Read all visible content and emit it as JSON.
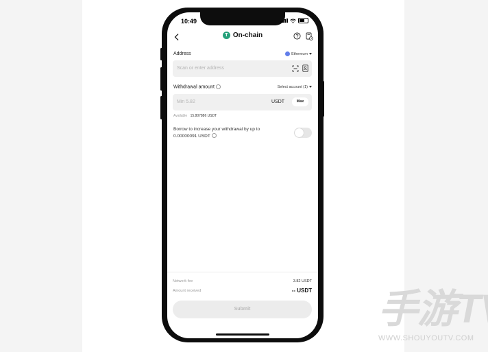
{
  "status_bar": {
    "time": "10:49"
  },
  "header": {
    "title": "On-chain",
    "coin_letter": "T"
  },
  "address": {
    "label": "Address",
    "network": "Ethereum",
    "placeholder": "Scan or enter address"
  },
  "withdrawal": {
    "label": "Withdrawal amount",
    "select_account": "Select account (1)",
    "placeholder": "Min 5.82",
    "currency": "USDT",
    "max_label": "Max",
    "available_label": "Available",
    "available_value": "15.807886 USDT"
  },
  "borrow": {
    "text_line1": "Borrow to increase your withdrawal by up to",
    "text_line2": "0.00000091 USDT",
    "enabled": false
  },
  "summary": {
    "network_fee_label": "Network fee",
    "network_fee_value": "3.82 USDT",
    "amount_received_label": "Amount received",
    "amount_received_value": "-- USDT"
  },
  "submit_label": "Submit",
  "watermark": {
    "logo": "手游TV",
    "url": "WWW.SHOUYOUTV.COM"
  },
  "colors": {
    "usdt": "#26a17b",
    "ethereum": "#627eea"
  }
}
